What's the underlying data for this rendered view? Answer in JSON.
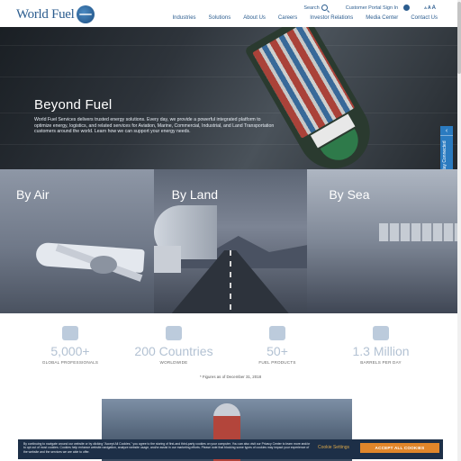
{
  "header": {
    "logo_text": "World Fuel",
    "search_label": "Search",
    "portal_label": "Customer Portal Sign In",
    "font_size_controls": [
      "A",
      "A",
      "A"
    ],
    "nav": [
      "Industries",
      "Solutions",
      "About Us",
      "Careers",
      "Investor Relations",
      "Media Center",
      "Contact Us"
    ]
  },
  "hero": {
    "title": "Beyond Fuel",
    "text": "World Fuel Services delivers trusted energy solutions. Every day, we provide a powerful integrated platform to optimize energy, logistics, and related services for Aviation, Marine, Commercial, Industrial, and Land Transportation customers around the world. Learn how we can support your energy needs."
  },
  "stay_connected": {
    "label": "Stay Connected",
    "arrow": "‹"
  },
  "panels": [
    {
      "title": "By Air"
    },
    {
      "title": "By Land"
    },
    {
      "title": "By Sea"
    }
  ],
  "stats": [
    {
      "value": "5,000+",
      "label": "GLOBAL PROFESSIONALS",
      "icon": "people-icon"
    },
    {
      "value": "200 Countries",
      "label": "WORLDWIDE",
      "icon": "buildings-icon"
    },
    {
      "value": "50+",
      "label": "FUEL PRODUCTS",
      "icon": "fuel-pump-icon"
    },
    {
      "value": "1.3 Million",
      "label": "BARRELS PER DAY",
      "icon": "barrels-icon"
    }
  ],
  "figures_note": "* Figures as of December 31, 2018",
  "cookie": {
    "text": "By continuing to navigate around our website or by clicking \"Accept All Cookies,\" you agree to the storing of first-and third-party cookies on your computer. You can also visit our Privacy Center to learn more and/or to opt out of most cookies. Cookies help enhance website navigation, analyze website usage, and/or assist in our marketing efforts. Please note that blocking some types of cookies may impact your experience of the website and the services we are able to offer.",
    "settings_label": "Cookie Settings",
    "accept_label": "ACCEPT ALL COOKIES"
  },
  "colors": {
    "brand_blue": "#2c5d8f",
    "accent_orange": "#e1862a",
    "banner_bg": "#1d2f47",
    "stat_blue": "#b3c2d3"
  }
}
